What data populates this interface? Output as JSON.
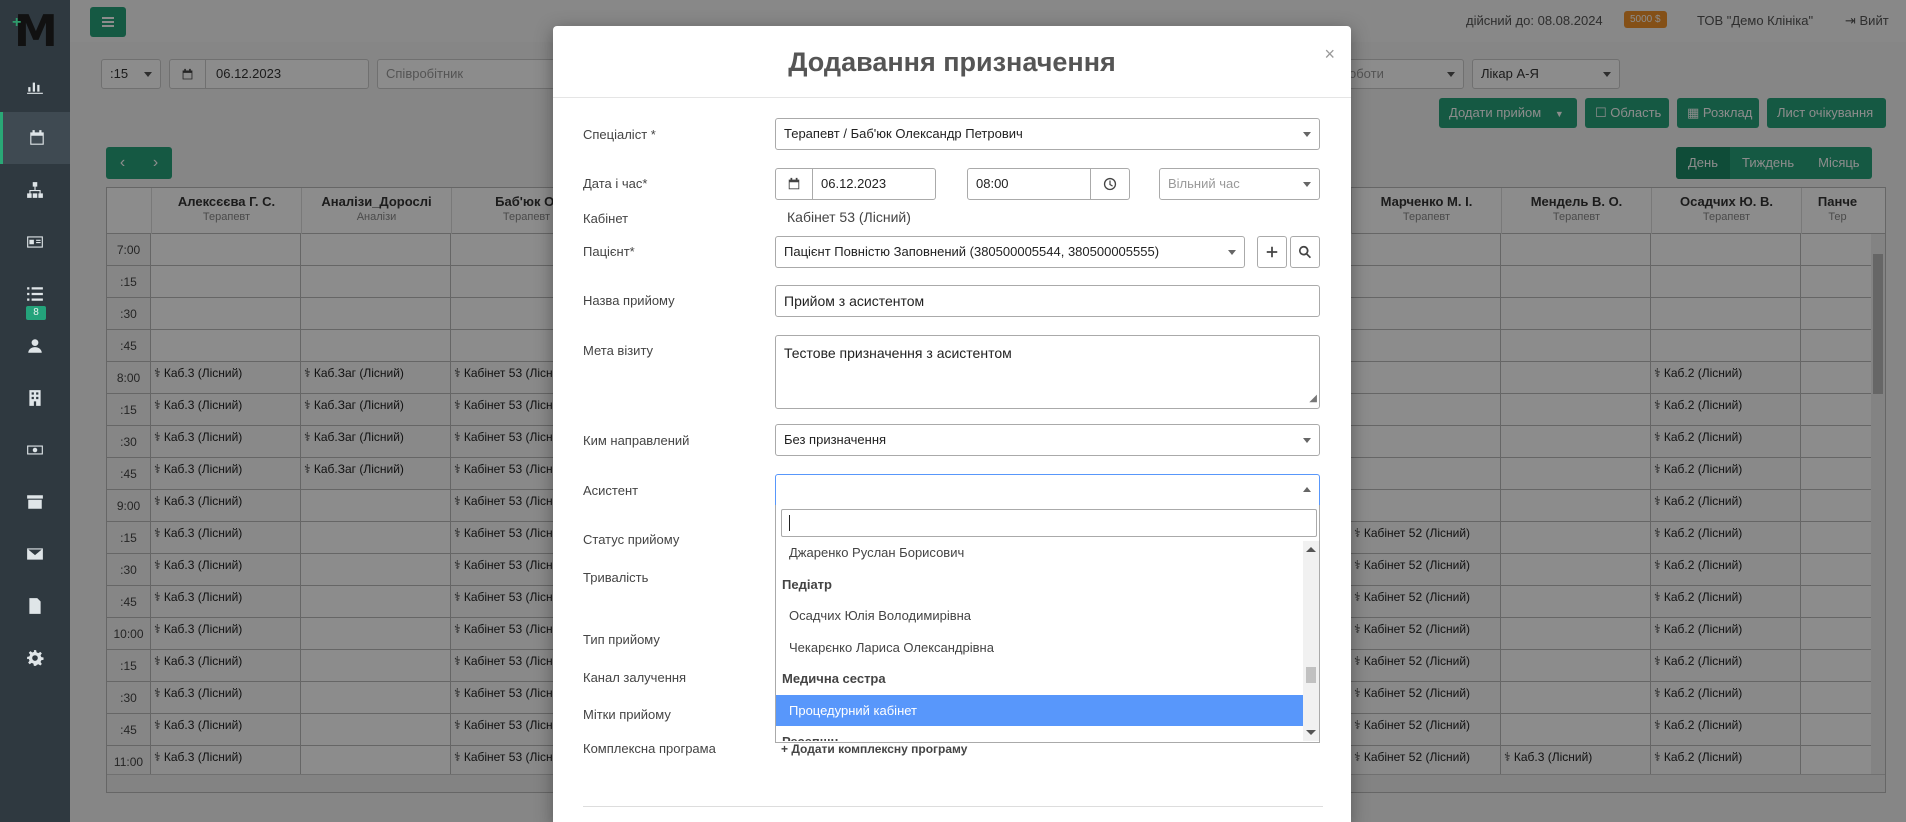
{
  "topbar": {
    "active_until": "дійсний до: 08.08.2024",
    "balance": "5000 $",
    "company": "ТОВ \"Демо Клініка\"",
    "logout": "Вийт"
  },
  "sidebar": {
    "badge": "8"
  },
  "filters": {
    "interval": ":15",
    "date": "06.12.2023",
    "employee_placeholder": "Співробітник",
    "work_placeholder": "оботи",
    "sort": "Лікар А-Я"
  },
  "actions": {
    "add_appointment": "Додати прийом",
    "area": "Область",
    "schedule": "Розклад",
    "waitlist": "Лист очікування"
  },
  "views": {
    "day": "День",
    "week": "Тиждень",
    "month": "Місяць"
  },
  "calendar": {
    "columns": [
      {
        "name": "Алексєєва Г. С.",
        "spec": "Терапевт"
      },
      {
        "name": "Аналізи_Дорослі",
        "spec": "Аналізи"
      },
      {
        "name": "Баб'юк О.",
        "spec": "Терапевт"
      },
      {
        "name": "Марченко М. І.",
        "spec": "Терапевт"
      },
      {
        "name": "Мендель В. О.",
        "spec": "Терапевт"
      },
      {
        "name": "Осадчих Ю. В.",
        "spec": "Терапевт"
      },
      {
        "name": "Панче",
        "spec": "Тер"
      }
    ],
    "times": [
      "7:00",
      ":15",
      ":30",
      ":45",
      "8:00",
      ":15",
      ":30",
      ":45",
      "9:00",
      ":15",
      ":30",
      ":45",
      "10:00",
      ":15",
      ":30",
      ":45",
      "11:00"
    ],
    "labels": {
      "kab3": "Каб.3 (Лісний)",
      "kabzag": "Каб.Заг (Лісний)",
      "kab53": "Кабінет 53 (Лісний)",
      "kab52": "Кабінет 52 (Лісний)",
      "kab2": "Каб.2 (Лісний)"
    }
  },
  "modal": {
    "title": "Додавання призначення",
    "close": "×",
    "specialist_label": "Спеціаліст *",
    "specialist_value": "Терапевт / Баб'юк Олександр Петрович",
    "datetime_label": "Дата і час*",
    "date_value": "06.12.2023",
    "time_value": "08:00",
    "free_time_placeholder": "Вільний час",
    "cabinet_label": "Кабінет",
    "cabinet_value": "Кабінет 53 (Лісний)",
    "patient_label": "Пацієнт*",
    "patient_value": "Пацієнт Повністю Заповнений (380500005544, 380500005555)",
    "name_label": "Назва прийому",
    "name_value": "Прийом з асистентом",
    "goal_label": "Мета візиту",
    "goal_value": "Тестове призначення з асистентом",
    "referred_label": "Ким направлений",
    "referred_value": "Без призначення",
    "assistant_label": "Асистент",
    "status_label": "Статус прийому",
    "duration_label": "Тривалість",
    "type_label": "Тип прийому",
    "channel_label": "Канал залучення",
    "tags_label": "Мітки прийому",
    "program_label": "Комплексна програма",
    "add_program": "Додати комплексну програму"
  },
  "dropdown": {
    "items": [
      {
        "type": "item",
        "label": "Джаренко Руслан Борисович"
      },
      {
        "type": "group",
        "label": "Педіатр"
      },
      {
        "type": "item",
        "label": "Осадчих Юлія Володимирівна"
      },
      {
        "type": "item",
        "label": "Чекарєнко Лариса Олександрівна"
      },
      {
        "type": "group",
        "label": "Медична сестра"
      },
      {
        "type": "item",
        "label": "Процедурний кабінет",
        "highlight": true
      },
      {
        "type": "group",
        "label": "Ресепшн"
      }
    ]
  }
}
